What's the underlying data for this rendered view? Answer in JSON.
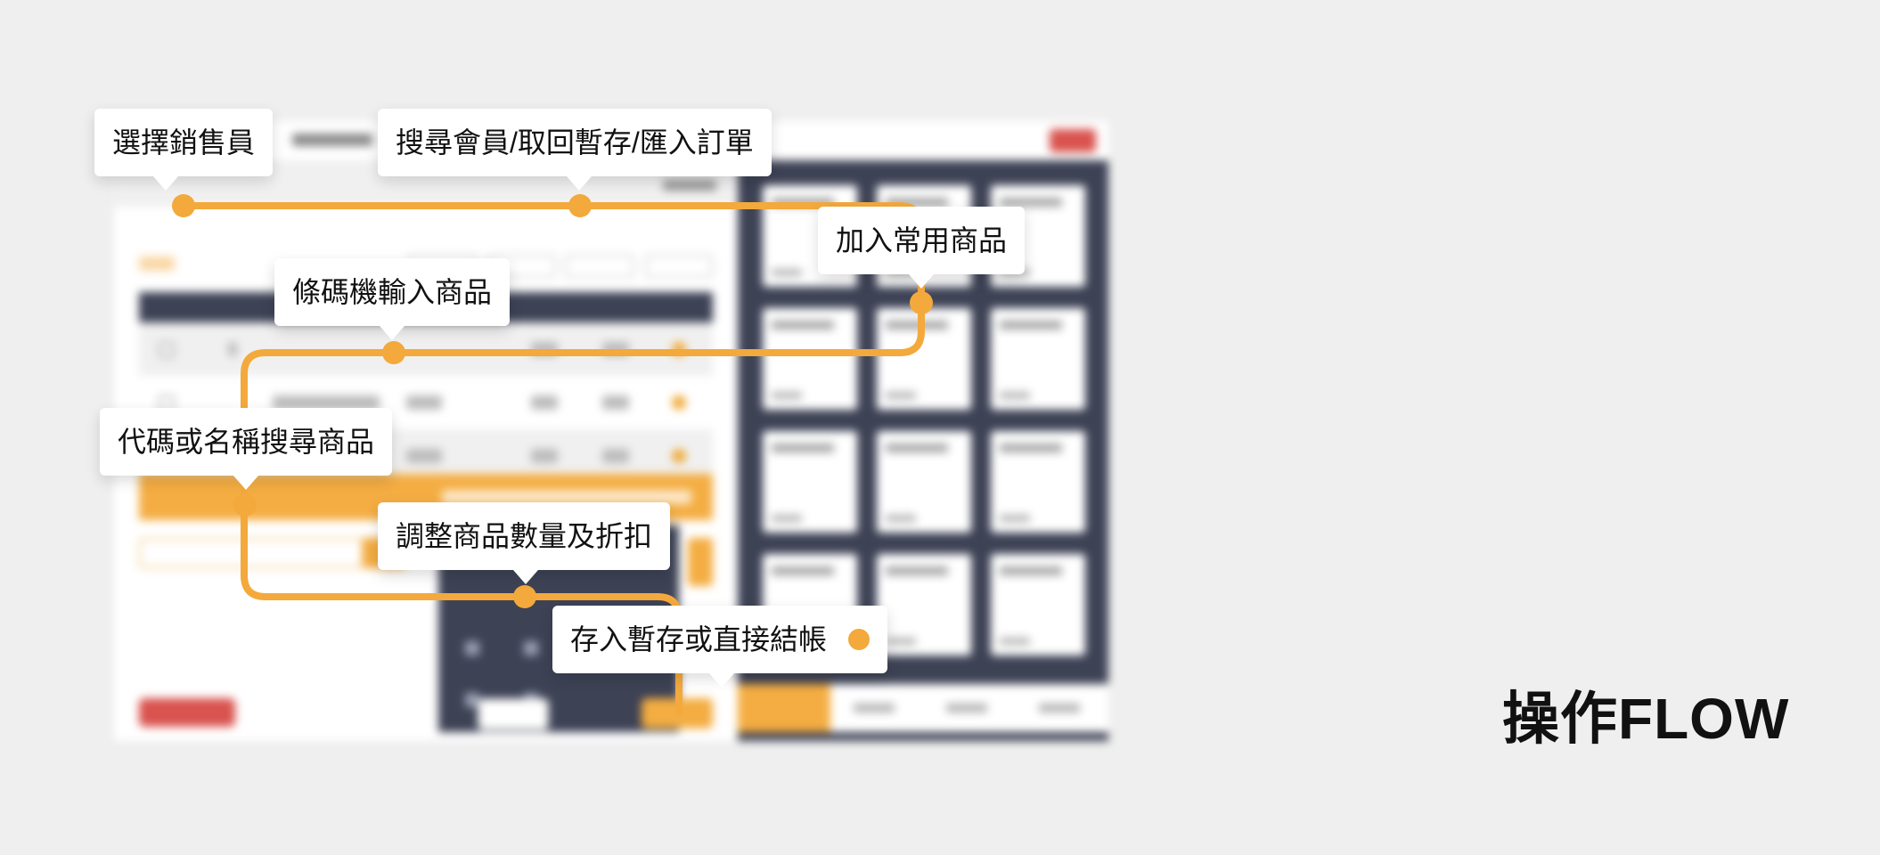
{
  "title": "操作FLOW",
  "accent_color": "#f3a93c",
  "steps": [
    {
      "label": "選擇銷售員"
    },
    {
      "label": "搜尋會員/取回暫存/匯入訂單"
    },
    {
      "label": "加入常用商品"
    },
    {
      "label": "條碼機輸入商品"
    },
    {
      "label": "代碼或名稱搜尋商品"
    },
    {
      "label": "調整商品數量及折扣"
    },
    {
      "label": "存入暫存或直接結帳"
    }
  ],
  "background_screenshot": {
    "note_icon": "blurred-pos-screenshot"
  }
}
